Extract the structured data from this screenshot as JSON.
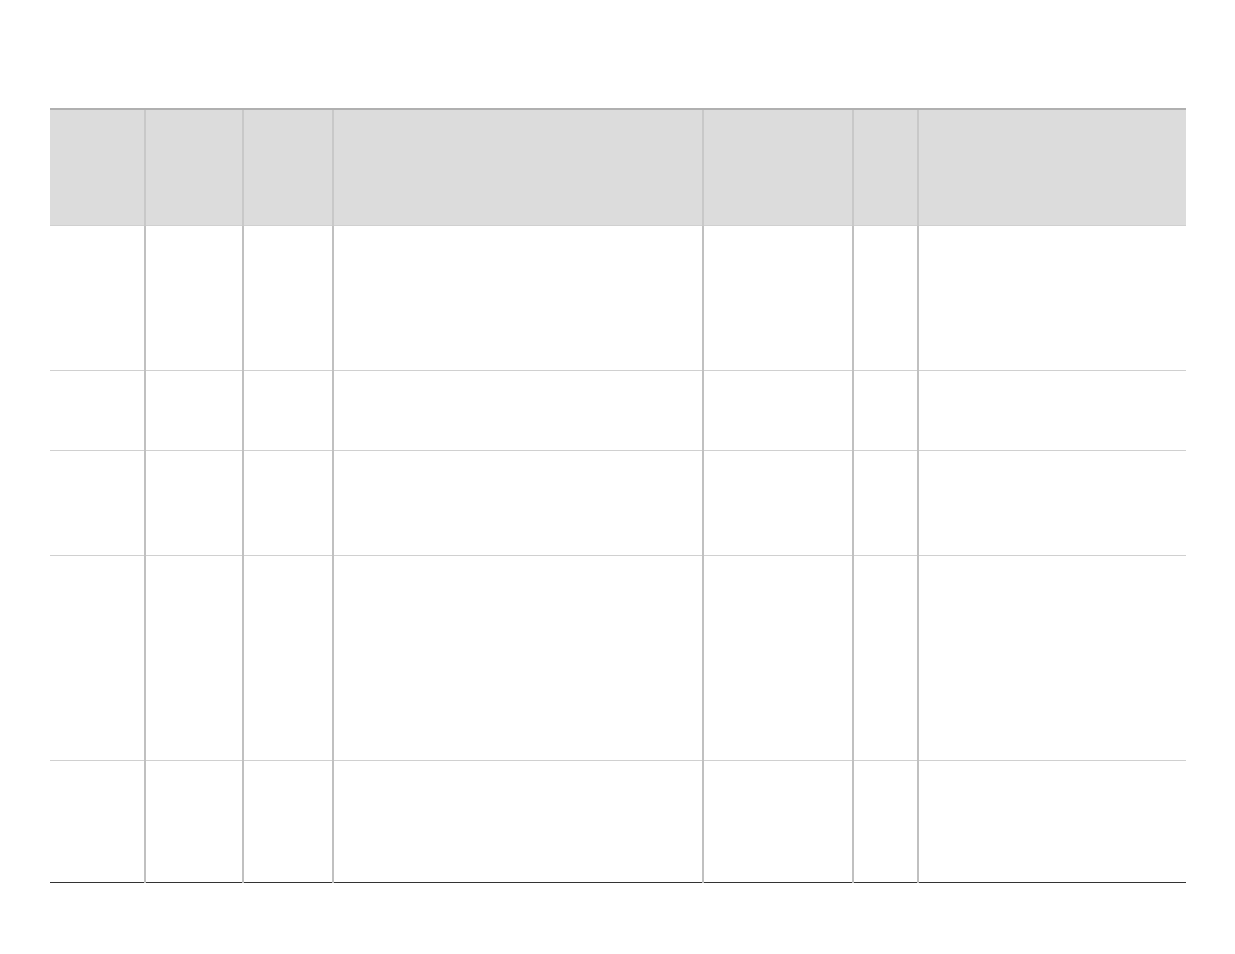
{
  "table": {
    "headers": [
      "",
      "",
      "",
      "",
      "",
      "",
      ""
    ],
    "rows": [
      {
        "cells": [
          "",
          "",
          "",
          "",
          "",
          "",
          ""
        ]
      },
      {
        "cells": [
          "",
          "",
          "",
          "",
          "",
          "",
          ""
        ]
      },
      {
        "cells": [
          "",
          "",
          "",
          "",
          "",
          "",
          ""
        ]
      },
      {
        "cells": [
          "",
          "",
          "",
          "",
          "",
          "",
          ""
        ]
      },
      {
        "cells": [
          "",
          "",
          "",
          "",
          "",
          "",
          ""
        ]
      }
    ]
  }
}
